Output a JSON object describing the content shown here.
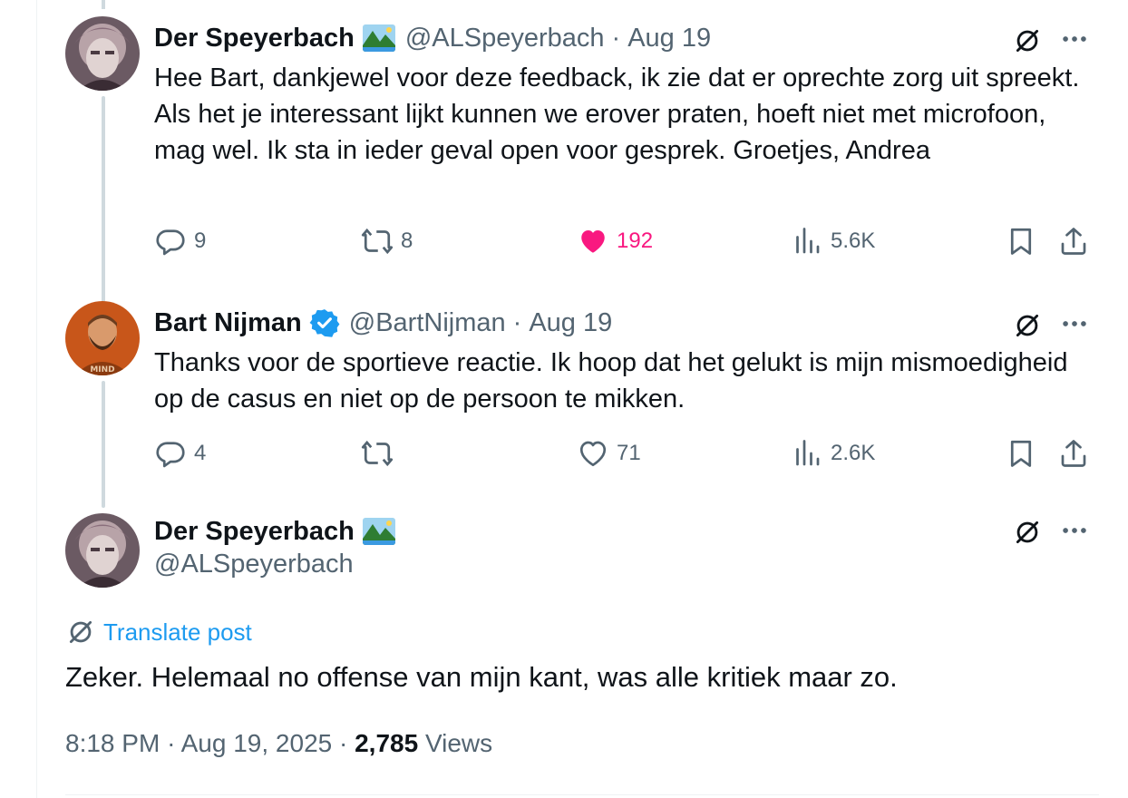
{
  "tweets": [
    {
      "name": "Der Speyerbach",
      "handle": "@ALSpeyerbach",
      "separator": "·",
      "date": "Aug 19",
      "text": "Hee Bart, dankjewel voor deze feedback, ik zie dat er oprechte zorg uit spreekt. Als het je interessant lijkt kunnen we erover praten, hoeft niet met microfoon, mag wel. Ik sta in ieder geval open voor gesprek. Groetjes, Andrea",
      "replies": "9",
      "reposts": "8",
      "likes": "192",
      "views": "5.6K",
      "liked": true
    },
    {
      "name": "Bart Nijman",
      "handle": "@BartNijman",
      "separator": "·",
      "date": "Aug 19",
      "text": "Thanks voor de sportieve reactie. Ik hoop dat het gelukt is mijn mismoedigheid op de casus en niet op de persoon te mikken.",
      "replies": "4",
      "reposts": "",
      "likes": "71",
      "views": "2.6K",
      "liked": false,
      "verified": true
    }
  ],
  "main": {
    "name": "Der Speyerbach",
    "handle": "@ALSpeyerbach",
    "translate_label": "Translate post",
    "text": "Zeker. Helemaal no offense van mijn kant, was alle kritiek maar zo.",
    "time": "8:18 PM",
    "separator": "·",
    "date": "Aug 19, 2025",
    "views_count": "2,785",
    "views_label": "Views"
  },
  "colors": {
    "accent": "#1d9bf0",
    "like": "#f91880",
    "secondary_text": "#536471",
    "thread_line": "#cfd9de"
  },
  "icons": [
    "grok-icon",
    "more-icon",
    "reply-icon",
    "repost-icon",
    "like-icon",
    "views-icon",
    "bookmark-icon",
    "share-icon",
    "translate-icon",
    "verified-badge-icon",
    "landscape-emoji-icon"
  ]
}
